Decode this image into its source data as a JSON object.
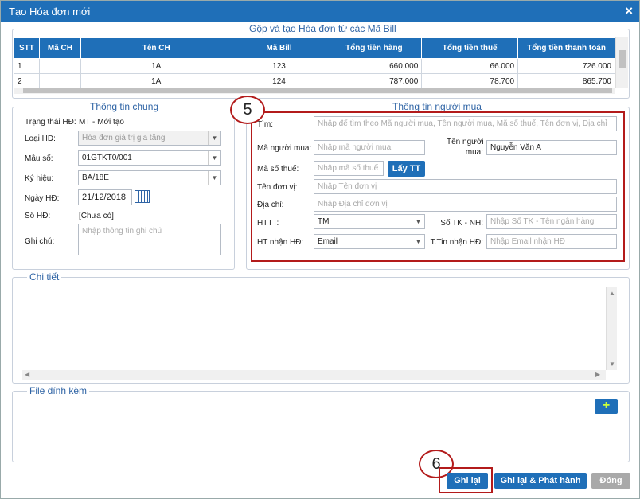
{
  "dialog": {
    "title": "Tạo Hóa đơn mới",
    "close_icon": "×"
  },
  "bills": {
    "legend": "Gộp và tạo Hóa đơn từ các Mã Bill",
    "columns": [
      "STT",
      "Mã CH",
      "Tên CH",
      "Mã Bill",
      "Tổng tiền hàng",
      "Tổng tiền thuế",
      "Tổng tiền thanh toán"
    ],
    "rows": [
      {
        "stt": "1",
        "ma_ch": "",
        "ten_ch": "1A",
        "ma_bill": "123",
        "tien_hang": "660.000",
        "tien_thue": "66.000",
        "thanh_toan": "726.000"
      },
      {
        "stt": "2",
        "ma_ch": "",
        "ten_ch": "1A",
        "ma_bill": "124",
        "tien_hang": "787.000",
        "tien_thue": "78.700",
        "thanh_toan": "865.700"
      }
    ]
  },
  "general": {
    "legend": "Thông tin chung",
    "status_label": "Trạng thái HĐ:",
    "status_value": "MT - Mới tạo",
    "type_label": "Loại HĐ:",
    "type_value": "Hóa đơn giá trị gia tăng",
    "form_label": "Mẫu số:",
    "form_value": "01GTKT0/001",
    "symbol_label": "Ký hiệu:",
    "symbol_value": "BA/18E",
    "date_label": "Ngày HĐ:",
    "date_value": "21/12/2018",
    "number_label": "Số HĐ:",
    "number_value": "[Chưa có]",
    "note_label": "Ghi chú:",
    "note_placeholder": "Nhập thông tin ghi chú"
  },
  "buyer": {
    "legend": "Thông tin người mua",
    "search_label": "Tìm:",
    "search_placeholder": "Nhập để tìm theo Mã người mua, Tên người mua, Mã số thuế, Tên đơn vị, Địa chỉ",
    "code_label": "Mã người mua:",
    "code_placeholder": "Nhập mã người mua",
    "name_label_1": "Tên người",
    "name_label_2": "mua:",
    "name_value": "Nguyễn Văn A",
    "tax_label": "Mã số thuế:",
    "tax_placeholder": "Nhập mã số thuế",
    "tax_button": "Lấy TT",
    "unit_label": "Tên đơn vị:",
    "unit_placeholder": "Nhập Tên đơn vị",
    "address_label": "Địa chỉ:",
    "address_placeholder": "Nhập Địa chỉ đơn vị",
    "pay_label": "HTTT:",
    "pay_value": "TM",
    "account_label": "Số TK - NH:",
    "account_placeholder": "Nhập Số TK - Tên ngân hàng",
    "receive_label": "HT nhận HĐ:",
    "receive_value": "Email",
    "email_label": "T.Tin nhận HĐ:",
    "email_placeholder": "Nhập Email nhận HĐ"
  },
  "detail": {
    "legend": "Chi tiết"
  },
  "attach": {
    "legend": "File đính kèm",
    "add_label": "+"
  },
  "callouts": {
    "five": "5",
    "six": "6"
  },
  "footer": {
    "save": "Ghi lại",
    "save_publish": "Ghi lại & Phát hành",
    "close": "Đóng"
  }
}
